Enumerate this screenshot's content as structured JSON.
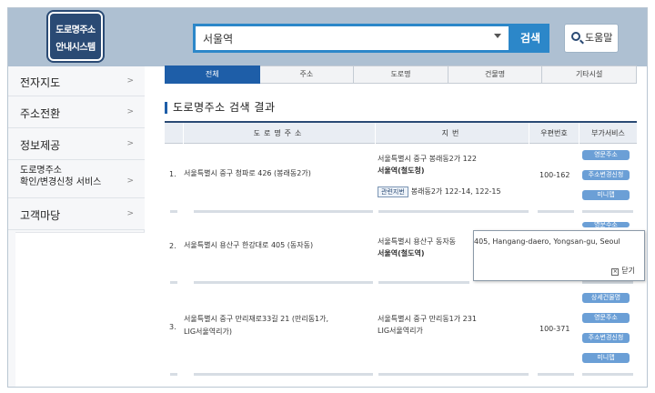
{
  "header": {
    "logo_line1": "도로명주소",
    "logo_line2": "안내시스템",
    "search_value": "서울역",
    "search_button": "검색",
    "help_button": "도움말"
  },
  "sidebar": {
    "items": [
      {
        "label": "전자지도"
      },
      {
        "label": "주소전환"
      },
      {
        "label": "정보제공"
      },
      {
        "label_line1": "도로명주소",
        "label_line2": "확인/변경신청 서비스"
      },
      {
        "label": "고객마당"
      }
    ]
  },
  "tabs": [
    {
      "label": "전체",
      "active": true
    },
    {
      "label": "주소"
    },
    {
      "label": "도로명"
    },
    {
      "label": "건물명"
    },
    {
      "label": "기타시설"
    }
  ],
  "results": {
    "title": "도로명주소 검색 결과",
    "columns": [
      "도로명주소",
      "지번",
      "우편번호",
      "부가서비스"
    ],
    "rows": [
      {
        "no": "1.",
        "road_address": "서울특별시 중구 청파로 426 (봉래동2가)",
        "jibun_line1": "서울특별시 중구 봉래동2가 122",
        "jibun_line2": "서울역(철도청)",
        "related_label": "관련지번",
        "related_value": "봉래동2가 122-14, 122-15",
        "zip": "100-162",
        "services": [
          "영문주소",
          "주소변경신청",
          "미니맵"
        ]
      },
      {
        "no": "2.",
        "road_address": "서울특별시 용산구 한강대로 405 (동자동)",
        "jibun_line1": "서울특별시 용산구 동자동",
        "jibun_line2": "서울역(철도역)",
        "services": [
          "영문주소"
        ]
      },
      {
        "no": "3.",
        "road_address_line1": "서울특별시 중구 만리재로33길 21 (만리동1가,",
        "road_address_line2": "LIG서울역리가)",
        "jibun_line1": "서울특별시 중구 만리동1가 231",
        "jibun_line2": "LIG서울역리가",
        "zip": "100-371",
        "services": [
          "상세건물명",
          "영문주소",
          "주소변경신청",
          "미니맵"
        ]
      }
    ]
  },
  "tooltip": {
    "text": "405, Hangang-daero, Yongsan-gu, Seoul",
    "close_label": "닫기"
  },
  "colors": {
    "header_bg": "#aec0d2",
    "accent_blue": "#2c87c9",
    "tab_active": "#1e5ea8",
    "service_button": "#6b9fd6",
    "logo_bg": "#2a4a74"
  }
}
